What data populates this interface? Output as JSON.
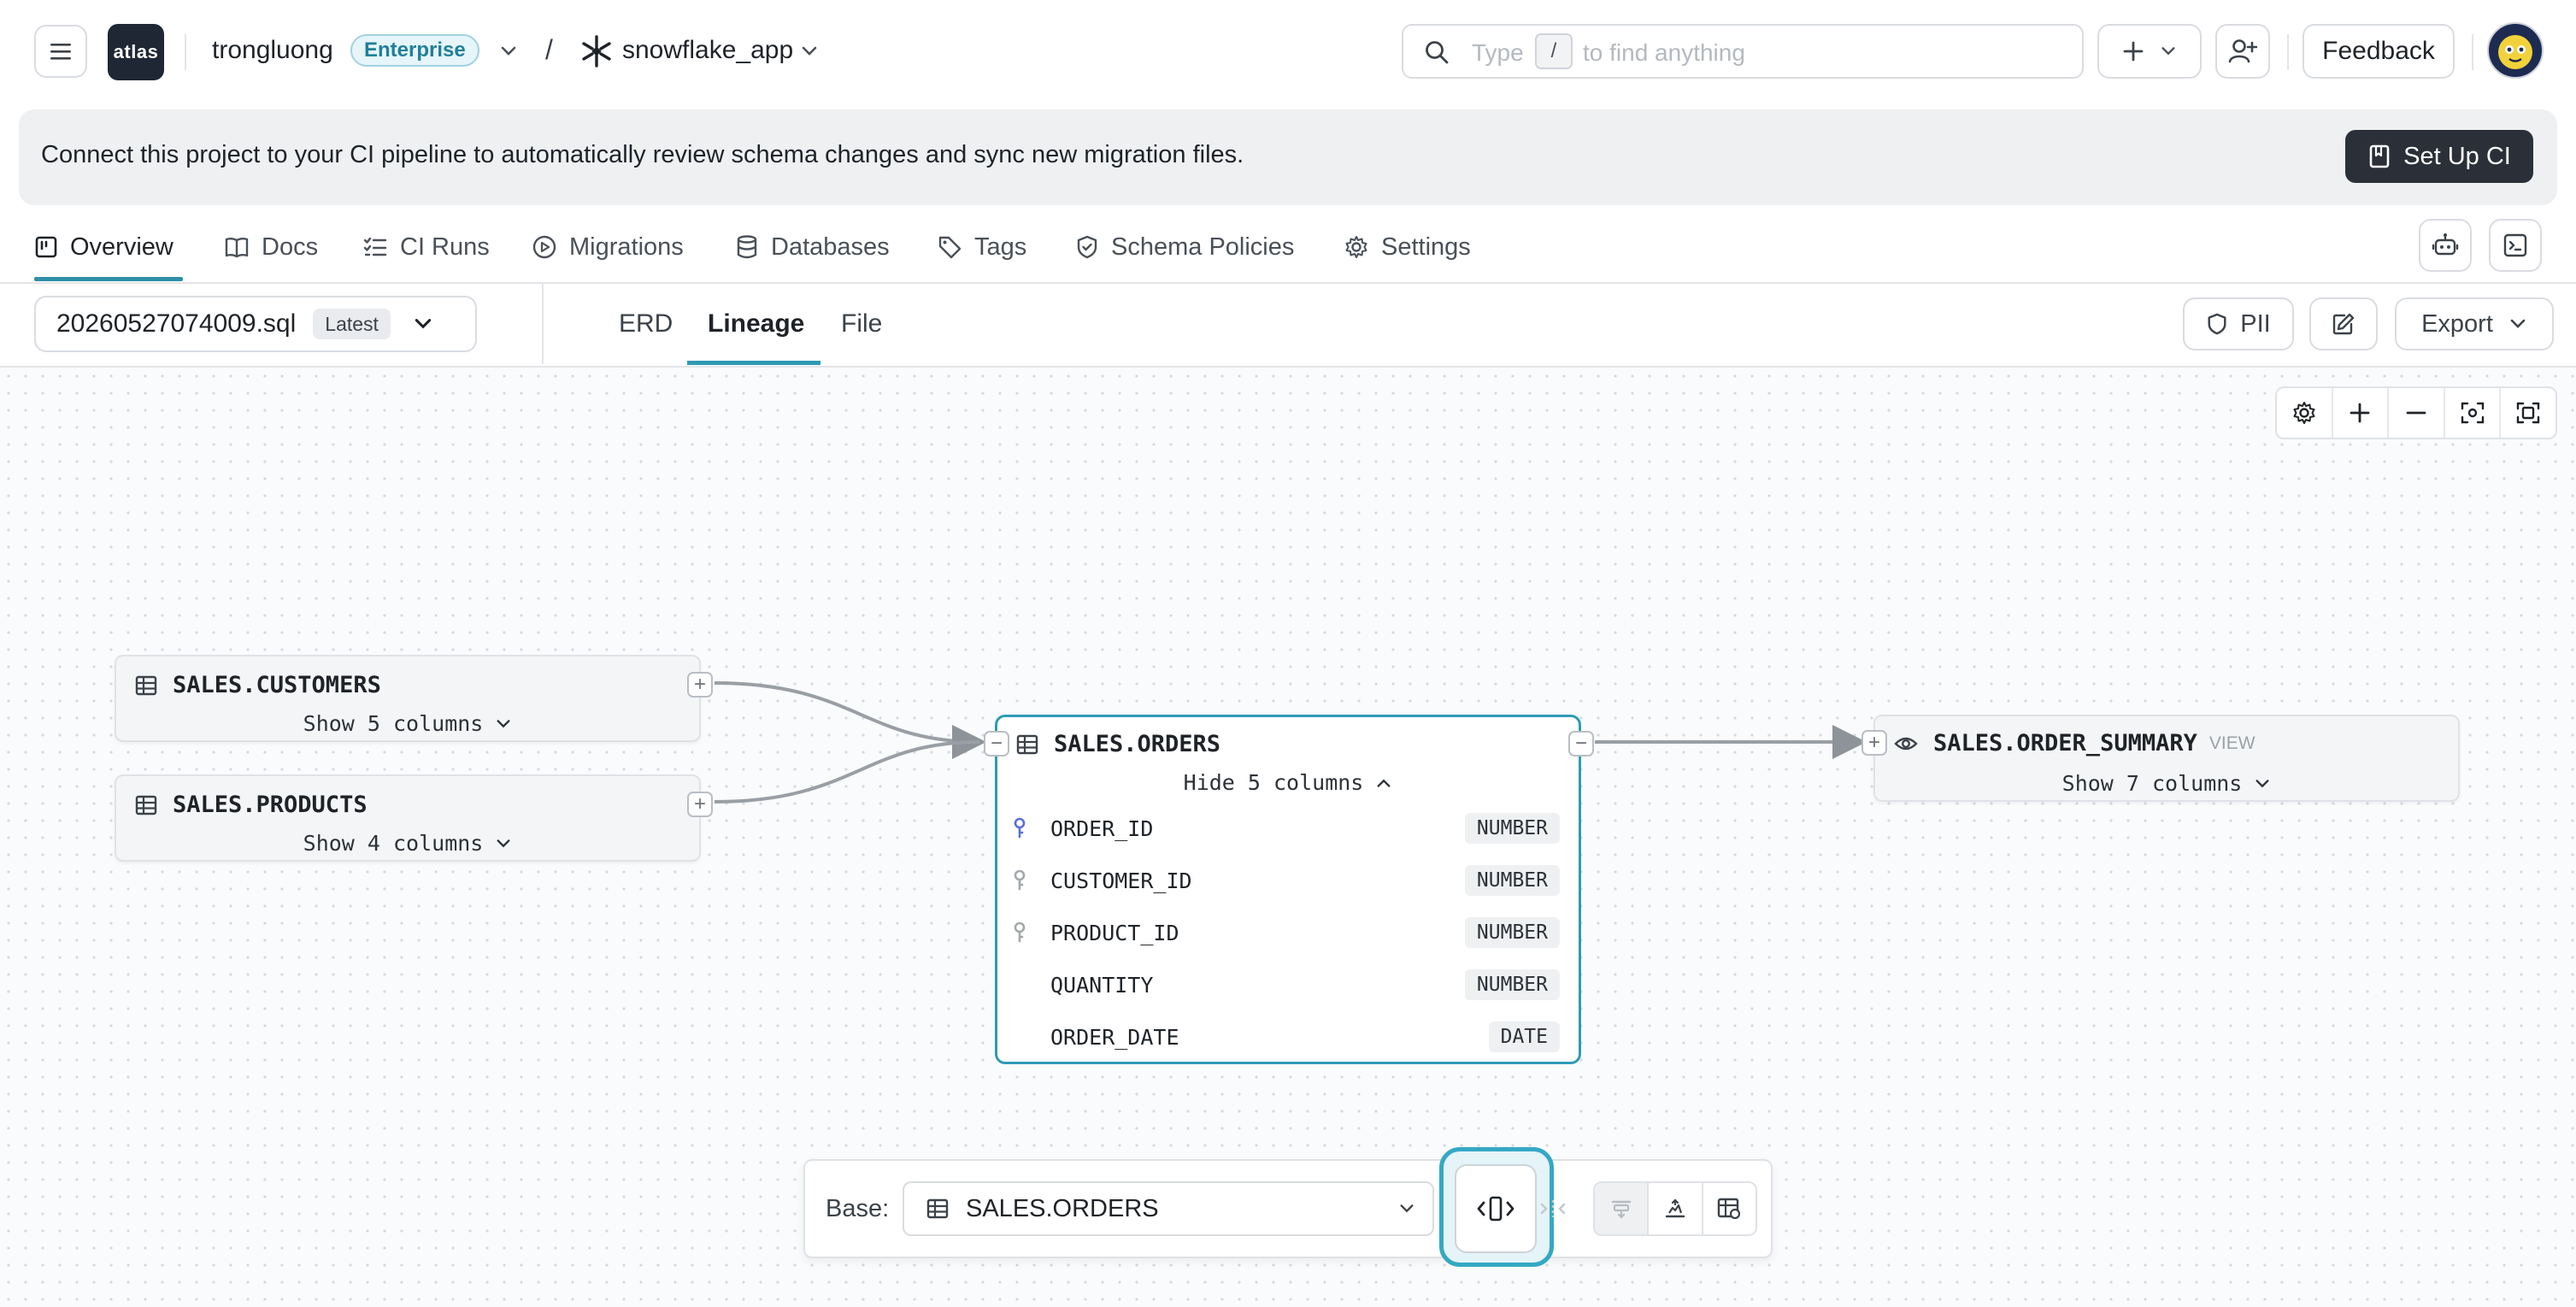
{
  "topbar": {
    "logo_text": "atlas",
    "org_name": "trongluong",
    "plan_badge": "Enterprise",
    "path_separator": "/",
    "project_name": "snowflake_app",
    "search_prefix": "Type",
    "search_key": "/",
    "search_suffix": "to find anything",
    "feedback_label": "Feedback"
  },
  "banner": {
    "message": "Connect this project to your CI pipeline to automatically review schema changes and sync new migration files.",
    "cta_label": "Set Up CI"
  },
  "tabs": [
    {
      "label": "Overview",
      "icon": "overview-icon",
      "active": true
    },
    {
      "label": "Docs",
      "icon": "book-icon"
    },
    {
      "label": "CI Runs",
      "icon": "list-check-icon"
    },
    {
      "label": "Migrations",
      "icon": "play-circle-icon"
    },
    {
      "label": "Databases",
      "icon": "database-icon"
    },
    {
      "label": "Tags",
      "icon": "tag-icon"
    },
    {
      "label": "Schema Policies",
      "icon": "shield-check-icon"
    },
    {
      "label": "Settings",
      "icon": "gear-icon"
    }
  ],
  "subbar": {
    "file_name": "20260527074009.sql",
    "file_badge": "Latest",
    "views": [
      "ERD",
      "Lineage",
      "File"
    ],
    "active_view": "Lineage",
    "pii_label": "PII",
    "export_label": "Export"
  },
  "nodes": {
    "customers": {
      "name": "SALES.CUSTOMERS",
      "toggle": "Show 5 columns"
    },
    "products": {
      "name": "SALES.PRODUCTS",
      "toggle": "Show 4 columns"
    },
    "orders": {
      "name": "SALES.ORDERS",
      "toggle": "Hide 5 columns",
      "columns": [
        {
          "name": "ORDER_ID",
          "type": "NUMBER",
          "key": "primary"
        },
        {
          "name": "CUSTOMER_ID",
          "type": "NUMBER",
          "key": "foreign"
        },
        {
          "name": "PRODUCT_ID",
          "type": "NUMBER",
          "key": "foreign"
        },
        {
          "name": "QUANTITY",
          "type": "NUMBER",
          "key": "none"
        },
        {
          "name": "ORDER_DATE",
          "type": "DATE",
          "key": "none"
        }
      ]
    },
    "summary": {
      "name": "SALES.ORDER_SUMMARY",
      "badge": "VIEW",
      "toggle": "Show 7 columns"
    }
  },
  "bottombar": {
    "base_label": "Base:",
    "base_value": "SALES.ORDERS"
  },
  "colors": {
    "accent": "#2f9ab5",
    "dark_button": "#2b3038",
    "badge_text": "#1f7f9a"
  }
}
